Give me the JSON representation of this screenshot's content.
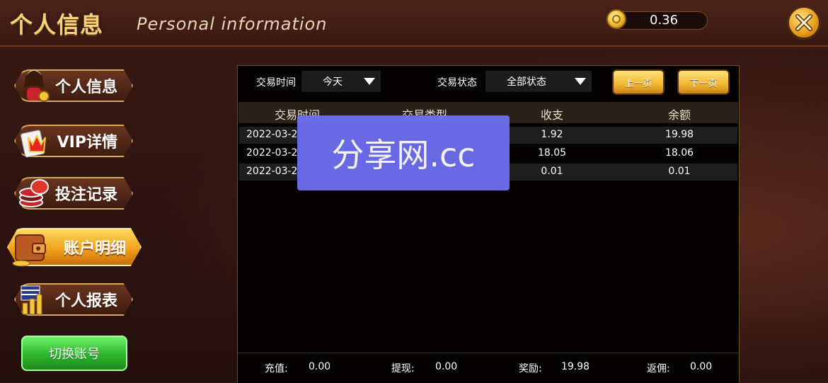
{
  "header": {
    "title_cn": "个人信息",
    "title_en": "Personal information",
    "balance": "0.36"
  },
  "sidebar": {
    "items": [
      {
        "label": "个人信息",
        "icon": "girl-avatar-icon"
      },
      {
        "label": "VIP详情",
        "icon": "vip-crown-icon"
      },
      {
        "label": "投注记录",
        "icon": "chips-icon"
      },
      {
        "label": "账户明细",
        "icon": "wallet-icon",
        "active": true
      },
      {
        "label": "个人报表",
        "icon": "report-chart-icon"
      }
    ],
    "switch_account": "切换账号"
  },
  "filters": {
    "time_label": "交易时间",
    "time_value": "今天",
    "status_label": "交易状态",
    "status_value": "全部状态",
    "prev_page": "上一页",
    "next_page": "下一页"
  },
  "table": {
    "headers": [
      "交易时间",
      "交易类型",
      "收支",
      "余额"
    ],
    "rows": [
      {
        "time": "2022-03-2",
        "amount": "1.92",
        "balance": "19.98"
      },
      {
        "time": "2022-03-2",
        "amount": "18.05",
        "balance": "18.06"
      },
      {
        "time": "2022-03-2",
        "amount": "0.01",
        "balance": "0.01"
      }
    ]
  },
  "footer": {
    "recharge_label": "充值:",
    "recharge_value": "0.00",
    "withdraw_label": "提现:",
    "withdraw_value": "0.00",
    "reward_label": "奖励:",
    "reward_value": "19.98",
    "rebate_label": "返佣:",
    "rebate_value": "0.00"
  },
  "watermark": "分享网.cc",
  "colors": {
    "gold": "#f6d27a",
    "active_tab": "#f0a21c",
    "switch_green": "#2fb52d",
    "watermark_bg": "#6e6ef0"
  }
}
